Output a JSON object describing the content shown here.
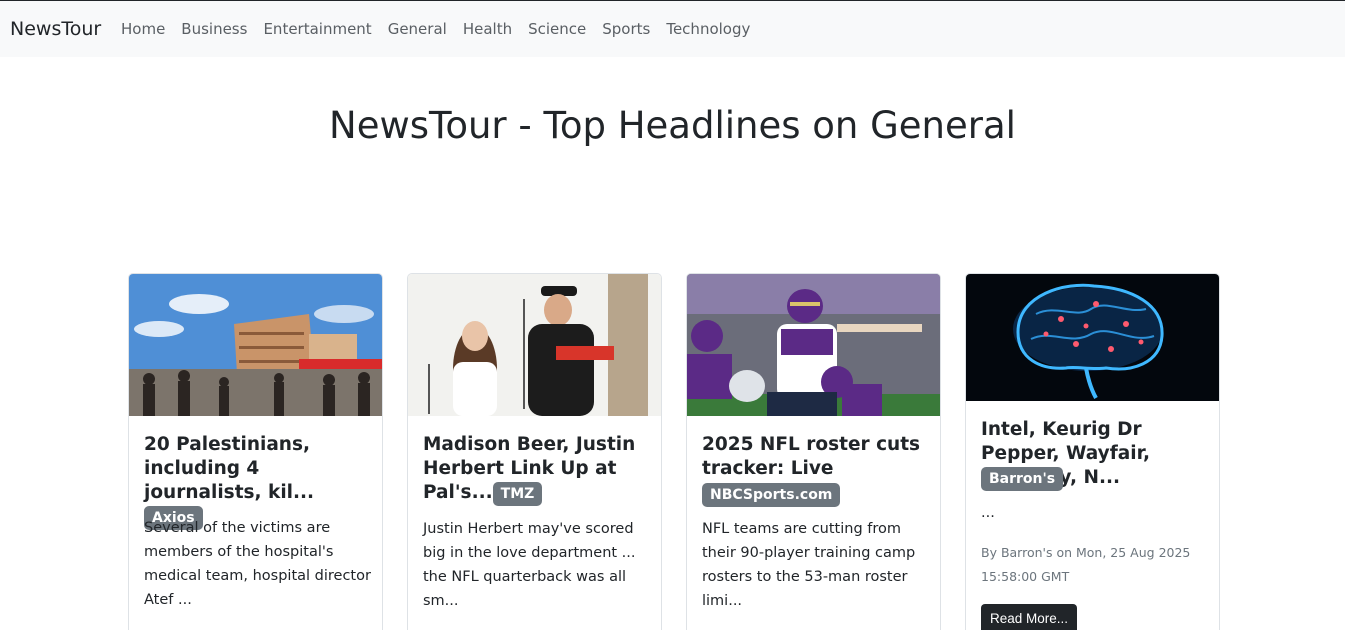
{
  "navbar": {
    "brand": "NewsTour",
    "links": [
      "Home",
      "Business",
      "Entertainment",
      "General",
      "Health",
      "Science",
      "Sports",
      "Technology"
    ]
  },
  "page": {
    "title": "NewsTour - Top Headlines on General"
  },
  "cards": [
    {
      "title": "20 Palestinians, including 4 journalists, kil...",
      "source": "Axios",
      "description": "Several of the victims are members of the hospital's medical team, hospital director Atef ..."
    },
    {
      "title": "Madison Beer, Justin Herbert Link Up at Pal's...",
      "source": "TMZ",
      "description": "Justin Herbert may've scored big in the love department ... the NFL quarterback was all sm..."
    },
    {
      "title": "2025 NFL roster cuts tracker: Live updates fr...",
      "source": "NBCSports.com",
      "description": "NFL teams are cutting from their 90-player training camp rosters to the 53-man roster limi..."
    },
    {
      "title": "Intel, Keurig Dr Pepper, Wayfair, Strategy, N...",
      "source": "Barron's",
      "description": "...",
      "meta": "By Barron's on Mon, 25 Aug 2025 15:58:00 GMT",
      "button": "Read More..."
    }
  ]
}
